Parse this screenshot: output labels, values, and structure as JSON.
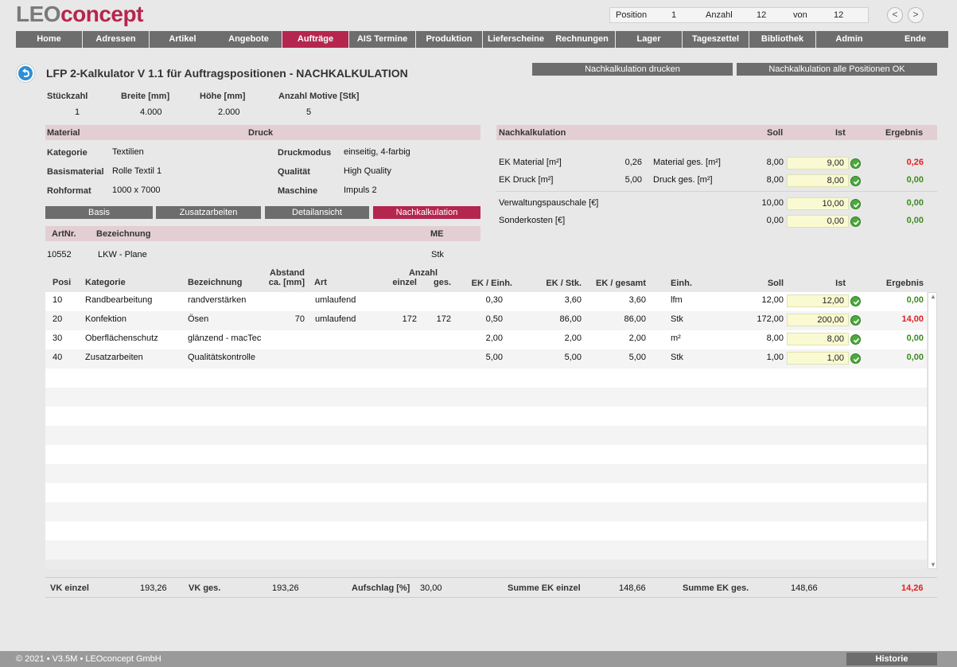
{
  "logo": {
    "part1": "LEO",
    "part2": "concept"
  },
  "position_box": {
    "position_label": "Position",
    "position_value": "1",
    "anzahl_label": "Anzahl",
    "anzahl_value": "12",
    "von_label": "von",
    "von_value": "12"
  },
  "nav_arrows": {
    "prev": "<",
    "next": ">"
  },
  "nav": [
    {
      "label": "Home"
    },
    {
      "label": "Adressen"
    },
    {
      "label": "Artikel"
    },
    {
      "label": "Angebote"
    },
    {
      "label": "Aufträge"
    },
    {
      "label": "AIS Termine"
    },
    {
      "label": "Produktion"
    },
    {
      "label": "Lieferscheine"
    },
    {
      "label": "Rechnungen"
    },
    {
      "label": "Lager"
    },
    {
      "label": "Tageszettel"
    },
    {
      "label": "Bibliothek"
    },
    {
      "label": "Admin"
    },
    {
      "label": "Ende"
    }
  ],
  "nav_active": "Aufträge",
  "page": {
    "title": "LFP 2-Kalkulator V 1.1 für Auftragspositionen - NACHKALKULATION",
    "btn_print": "Nachkalkulation drucken",
    "btn_all_ok": "Nachkalkulation alle Positionen OK"
  },
  "dims": {
    "labels": [
      "Stückzahl",
      "Breite [mm]",
      "Höhe [mm]",
      "Anzahl Motive [Stk]"
    ],
    "values": [
      "1",
      "4.000",
      "2.000",
      "5"
    ]
  },
  "material": {
    "header_material": "Material",
    "header_druck": "Druck",
    "kategorie_label": "Kategorie",
    "kategorie": "Textilien",
    "basismaterial_label": "Basismaterial",
    "basismaterial": "Rolle Textil 1",
    "rohformat_label": "Rohformat",
    "rohformat": "1000 x 7000",
    "druckmodus_label": "Druckmodus",
    "druckmodus": "einseitig, 4-farbig",
    "qualitaet_label": "Qualität",
    "qualitaet": "High Quality",
    "maschine_label": "Maschine",
    "maschine": "Impuls 2"
  },
  "tabs": [
    {
      "label": "Basis"
    },
    {
      "label": "Zusatzarbeiten"
    },
    {
      "label": "Detailansicht"
    },
    {
      "label": "Nachkalkulation"
    }
  ],
  "article": {
    "h_artnr": "ArtNr.",
    "h_bez": "Bezeichnung",
    "h_me": "ME",
    "artnr": "10552",
    "bez": "LKW - Plane",
    "me": "Stk"
  },
  "nachkalk": {
    "header": "Nachkalkulation",
    "soll_label": "Soll",
    "ist_label": "Ist",
    "ergebnis_label": "Ergebnis",
    "rows": [
      {
        "l1": "EK Material [m²]",
        "v1": "0,26",
        "l2": "Material ges. [m²]",
        "soll": "8,00",
        "ist": "9,00",
        "ergebnis": "0,26",
        "status": "red"
      },
      {
        "l1": "EK Druck [m²]",
        "v1": "5,00",
        "l2": "Druck ges. [m²]",
        "soll": "8,00",
        "ist": "8,00",
        "ergebnis": "0,00",
        "status": "green"
      },
      {
        "l1": "Verwaltungspauschale [€]",
        "v1": "",
        "l2": "",
        "soll": "10,00",
        "ist": "10,00",
        "ergebnis": "0,00",
        "status": "green"
      },
      {
        "l1": "Sonderkosten [€]",
        "v1": "",
        "l2": "",
        "soll": "0,00",
        "ist": "0,00",
        "ergebnis": "0,00",
        "status": "green"
      }
    ]
  },
  "table": {
    "headers": {
      "posi": "Posi",
      "kategorie": "Kategorie",
      "bezeichnung": "Bezeichnung",
      "abstand1": "Abstand",
      "abstand2": "ca. [mm]",
      "art": "Art",
      "anzahl": "Anzahl",
      "einzel": "einzel",
      "ges": "ges.",
      "ek_einh": "EK / Einh.",
      "ek_stk": "EK / Stk.",
      "ek_gesamt": "EK / gesamt",
      "einh": "Einh.",
      "soll": "Soll",
      "ist": "Ist",
      "ergebnis": "Ergebnis"
    },
    "rows": [
      {
        "posi": "10",
        "kategorie": "Randbearbeitung",
        "bezeichnung": "randverstärken",
        "abstand": "",
        "art": "umlaufend",
        "einzel": "",
        "ges": "",
        "ek_einh": "0,30",
        "ek_stk": "3,60",
        "ek_gesamt": "3,60",
        "einh": "lfm",
        "soll": "12,00",
        "ist": "12,00",
        "ergebnis": "0,00",
        "status": "green"
      },
      {
        "posi": "20",
        "kategorie": "Konfektion",
        "bezeichnung": "Ösen",
        "abstand": "70",
        "art": "umlaufend",
        "einzel": "172",
        "ges": "172",
        "ek_einh": "0,50",
        "ek_stk": "86,00",
        "ek_gesamt": "86,00",
        "einh": "Stk",
        "soll": "172,00",
        "ist": "200,00",
        "ergebnis": "14,00",
        "status": "red"
      },
      {
        "posi": "30",
        "kategorie": "Oberflächenschutz",
        "bezeichnung": "glänzend - macTec",
        "abstand": "",
        "art": "",
        "einzel": "",
        "ges": "",
        "ek_einh": "2,00",
        "ek_stk": "2,00",
        "ek_gesamt": "2,00",
        "einh": "m²",
        "soll": "8,00",
        "ist": "8,00",
        "ergebnis": "0,00",
        "status": "green"
      },
      {
        "posi": "40",
        "kategorie": "Zusatzarbeiten",
        "bezeichnung": "Qualitätskontrolle",
        "abstand": "",
        "art": "",
        "einzel": "",
        "ges": "",
        "ek_einh": "5,00",
        "ek_stk": "5,00",
        "ek_gesamt": "5,00",
        "einh": "Stk",
        "soll": "1,00",
        "ist": "1,00",
        "ergebnis": "0,00",
        "status": "green"
      }
    ]
  },
  "summary": {
    "vk_einzel_label": "VK einzel",
    "vk_einzel": "193,26",
    "vk_ges_label": "VK ges.",
    "vk_ges": "193,26",
    "aufschlag_label": "Aufschlag [%]",
    "aufschlag": "30,00",
    "summe_ek_einzel_label": "Summe EK einzel",
    "summe_ek_einzel": "148,66",
    "summe_ek_ges_label": "Summe EK ges.",
    "summe_ek_ges": "148,66",
    "ergebnis": "14,26"
  },
  "footer": {
    "copyright": "© 2021 • V3.5M • LEOconcept GmbH",
    "historie": "Historie"
  },
  "colors": {
    "accent": "#b5264f",
    "button": "#6d6d6d",
    "band": "#e3cfd3",
    "ist_bg": "#fafad2",
    "ok_green": "#4caa3c",
    "result_red": "#e02020",
    "result_green": "#3d8b1f"
  }
}
